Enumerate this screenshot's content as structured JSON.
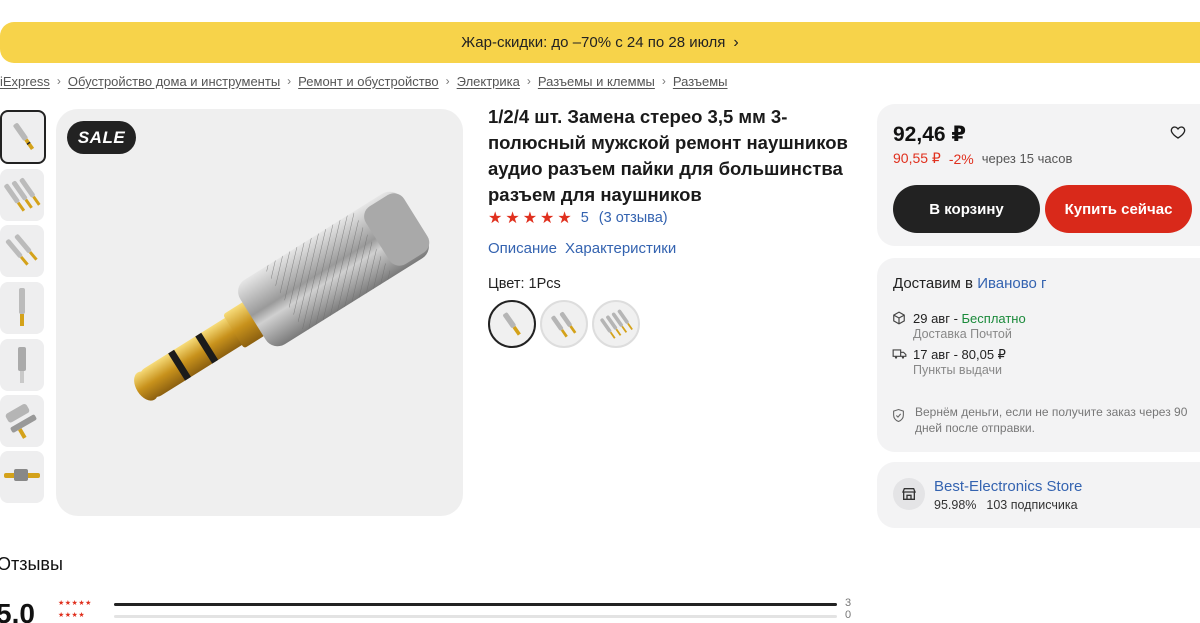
{
  "promo": {
    "text": "Жар-скидки: до –70% с 24 по 28 июля",
    "arrow": "chevron-right-icon"
  },
  "breadcrumb": {
    "items": [
      "iExpress",
      "Обустройство дома и инструменты",
      "Ремонт и обустройство",
      "Электрика",
      "Разъемы и клеммы",
      "Разъемы"
    ],
    "separator": ">"
  },
  "gallery": {
    "sale_badge": "SALE",
    "thumbnail_count": 7,
    "selected_index": 0
  },
  "product": {
    "title": "1/2/4 шт. Замена стерео 3,5 мм 3-полюсный мужской ремонт наушников аудио разъем пайки для большинства разъем для наушников",
    "rating_stars": "★★★★★",
    "rating_value": "5",
    "reviews_link": "(3 отзыва)",
    "tabs": [
      "Описание",
      "Характеристики"
    ],
    "color_label": "Цвет: 1Pcs",
    "color_options": 3,
    "selected_color": 0
  },
  "purchase": {
    "price": "92,46 ₽",
    "discount_price": "90,55 ₽",
    "discount_pct": "-2%",
    "discount_time": "через 15 часов",
    "cart_button": "В корзину",
    "buy_button": "Купить сейчас",
    "favorite_icon": "heart-icon"
  },
  "delivery": {
    "title": "Доставим в",
    "city": "Иваново г",
    "options": [
      {
        "date": "29 авг",
        "sep": " - ",
        "price": "Бесплатно",
        "method": "Доставка Почтой",
        "icon": "box-icon"
      },
      {
        "date": "17 авг",
        "sep": " - ",
        "price": "80,05 ₽",
        "method": "Пункты выдачи",
        "icon": "truck-icon"
      }
    ],
    "refund": "Вернём деньги, если не получите заказ через 90 дней после отправки.",
    "refund_icon": "shield-icon"
  },
  "store": {
    "name": "Best-Electronics Store",
    "rating": "95.98%",
    "subscribers": "103 подписчика",
    "icon": "store-icon"
  },
  "reviews": {
    "heading": "Отзывы",
    "score": "5.0",
    "rows": [
      {
        "stars": "★★★★★",
        "count": "3",
        "fraction": 1.0
      },
      {
        "stars": "★★★★",
        "count": "0",
        "fraction": 0.0
      }
    ]
  },
  "colors": {
    "accent_red": "#e0301e",
    "link_blue": "#3463b0",
    "promo_yellow": "#f7d34a",
    "dark_button": "#222222",
    "buy_red": "#d9291a"
  }
}
